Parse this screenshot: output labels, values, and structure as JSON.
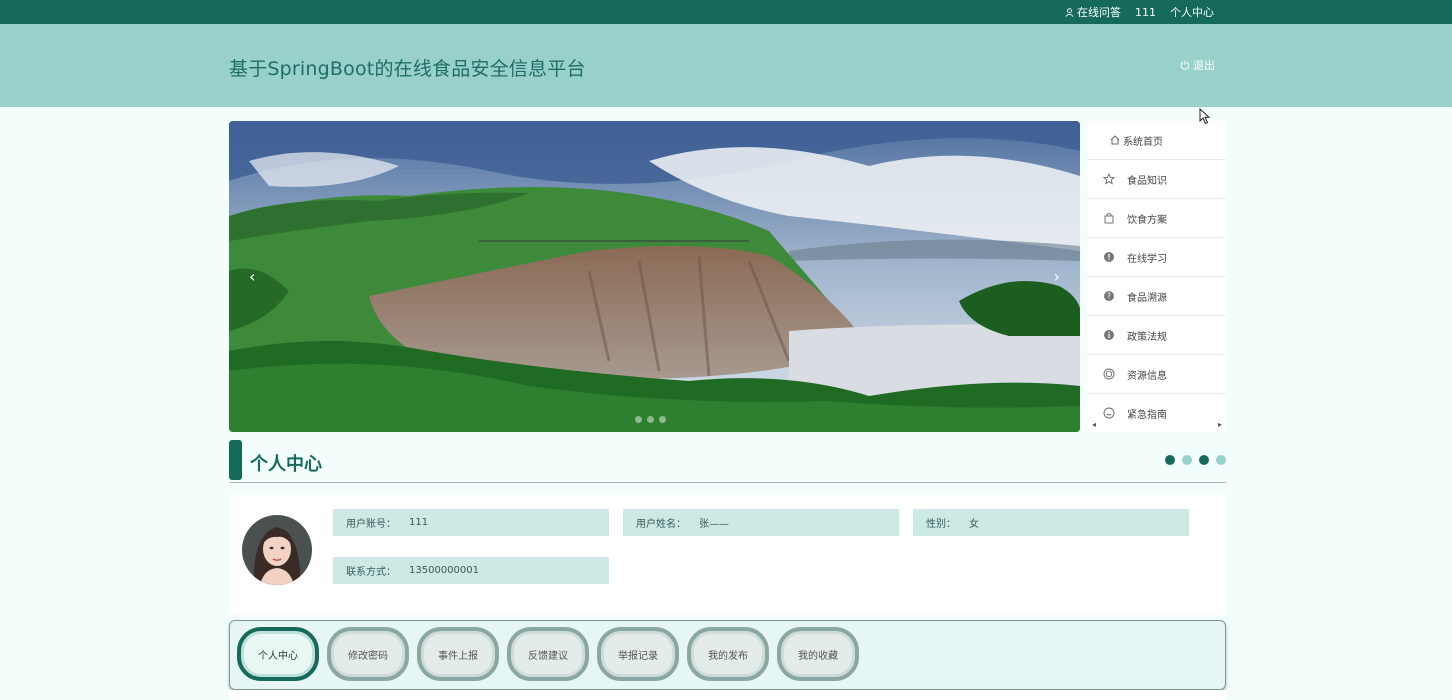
{
  "topbar": {
    "links": [
      {
        "label": "在线问答",
        "icon": "user-icon"
      },
      {
        "label": "111"
      },
      {
        "label": "个人中心"
      }
    ]
  },
  "header": {
    "title": "基于SpringBoot的在线食品安全信息平台",
    "logout_label": "退出",
    "logout_icon": "power-icon"
  },
  "banner": {
    "prev": "‹",
    "next": "›",
    "slide_count": 3
  },
  "sidenav": {
    "items": [
      {
        "label": "系统首页",
        "icon": "home-icon"
      },
      {
        "label": "食品知识",
        "icon": "star-icon"
      },
      {
        "label": "饮食方案",
        "icon": "bag-icon"
      },
      {
        "label": "在线学习",
        "icon": "exclamation-circle-icon"
      },
      {
        "label": "食品溯源",
        "icon": "question-circle-icon"
      },
      {
        "label": "政策法规",
        "icon": "info-circle-icon"
      },
      {
        "label": "资源信息",
        "icon": "target-icon"
      },
      {
        "label": "紧急指南",
        "icon": "smile-icon"
      }
    ],
    "scroll_left": "◂",
    "scroll_right": "▸"
  },
  "section": {
    "title": "个人中心",
    "dot_colors": [
      "#166a5c",
      "#98d0ca",
      "#166a5c",
      "#98d0ca"
    ]
  },
  "profile": {
    "fields": [
      {
        "key": "用户账号：",
        "value": "111"
      },
      {
        "key": "用户姓名：",
        "value": "张——"
      },
      {
        "key": "性别：",
        "value": "女"
      },
      {
        "key": "联系方式：",
        "value": "13500000001"
      }
    ]
  },
  "tabs": [
    {
      "label": "个人中心",
      "active": true
    },
    {
      "label": "修改密码"
    },
    {
      "label": "事件上报"
    },
    {
      "label": "反馈建议"
    },
    {
      "label": "举报记录"
    },
    {
      "label": "我的发布"
    },
    {
      "label": "我的收藏"
    }
  ],
  "colors": {
    "primary": "#166a5c",
    "header_bg": "#98d0ca",
    "field_bg": "#cce9e6",
    "page_bg": "#f2fdfc"
  }
}
